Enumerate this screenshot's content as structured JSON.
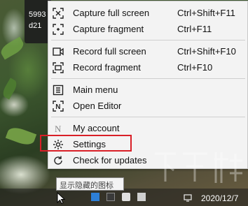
{
  "partial_window": {
    "lines": [
      "5993",
      "d21"
    ]
  },
  "menu": {
    "items": [
      {
        "label": "Capture full screen",
        "shortcut": "Ctrl+Shift+F11",
        "icon": "capture-full-icon"
      },
      {
        "label": "Capture fragment",
        "shortcut": "Ctrl+F11",
        "icon": "capture-fragment-icon"
      },
      {
        "label": "Record full screen",
        "shortcut": "Ctrl+Shift+F10",
        "icon": "record-full-icon"
      },
      {
        "label": "Record fragment",
        "shortcut": "Ctrl+F10",
        "icon": "record-fragment-icon"
      },
      {
        "label": "Main menu",
        "shortcut": "",
        "icon": "main-menu-icon"
      },
      {
        "label": "Open Editor",
        "shortcut": "",
        "icon": "editor-icon"
      },
      {
        "label": "My account",
        "shortcut": "",
        "icon": "account-icon"
      },
      {
        "label": "Settings",
        "shortcut": "",
        "icon": "gear-icon"
      },
      {
        "label": "Check for updates",
        "shortcut": "",
        "icon": "refresh-icon"
      }
    ],
    "highlighted_item": "Settings",
    "highlight_color": "#d91f27"
  },
  "taskbar": {
    "tray_tooltip": "显示隐藏的图标",
    "date": "2020/12/7"
  },
  "watermark": {
    "text": "下载吧"
  }
}
